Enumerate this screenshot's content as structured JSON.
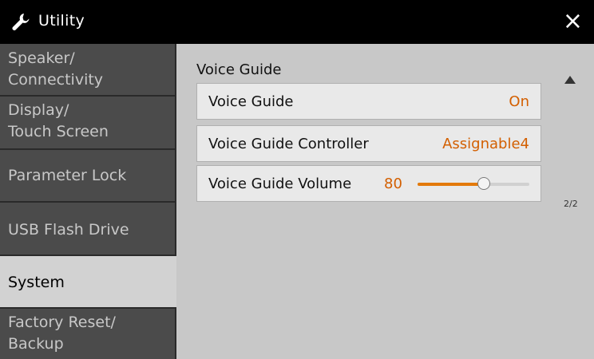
{
  "app": {
    "title": "Utility",
    "icon": "wrench-icon",
    "close_glyph": "×"
  },
  "sidebar": {
    "items": [
      {
        "label": "Speaker/\nConnectivity",
        "active": false
      },
      {
        "label": "Display/\nTouch Screen",
        "active": false
      },
      {
        "label": "Parameter Lock",
        "active": false
      },
      {
        "label": "USB Flash Drive",
        "active": false
      },
      {
        "label": "System",
        "active": true
      },
      {
        "label": "Factory Reset/\nBackup",
        "active": false
      }
    ]
  },
  "main": {
    "section_title": "Voice Guide",
    "rows": [
      {
        "label": "Voice Guide",
        "value": "On"
      },
      {
        "label": "Voice Guide Controller",
        "value": "Assignable4"
      },
      {
        "label": "Voice Guide Volume",
        "value": "80",
        "slider_fraction": 0.59
      }
    ],
    "page_indicator": "2/2"
  },
  "colors": {
    "accent": "#d35f00",
    "slider_fill": "#e37a0a",
    "title_bar": "#000000",
    "active_tab": "#d2d2d2"
  }
}
